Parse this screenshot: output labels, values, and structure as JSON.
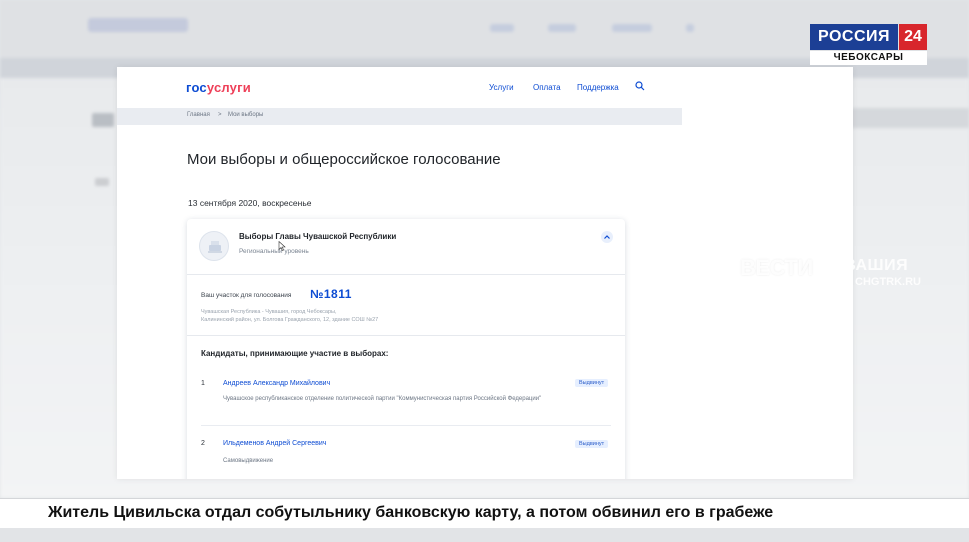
{
  "site": {
    "logo_part1": "гос",
    "logo_part2": "услуги",
    "nav": [
      "Услуги",
      "Оплата",
      "Поддержка"
    ],
    "breadcrumbs": [
      "Главная",
      ">",
      "Мои выборы"
    ]
  },
  "page": {
    "title": "Мои выборы и общероссийское голосование",
    "date": "13 сентября 2020, воскресенье"
  },
  "election": {
    "title": "Выборы Главы Чувашской Республики",
    "level": "Региональный уровень",
    "precinct_label": "Ваш участок для голосования",
    "precinct_number": "№1811",
    "address_line1": "Чувашская Республика - Чувашия, город Чебоксары,",
    "address_line2": "Калининский район, ул. Болгова Гражданского, 12, здание СОШ №27",
    "candidates_heading": "Кандидаты, принимающие участие в выборах:",
    "candidates": [
      {
        "num": "1",
        "name": "Андреев Александр Михайлович",
        "desc": "Чувашское республиканское отделение политической партии \"Коммунистическая партия Российской Федерации\"",
        "badge": "Выдвинут"
      },
      {
        "num": "2",
        "name": "Ильдеменов Андрей Сергеевич",
        "desc": "Самовыдвижение",
        "badge": "Выдвинут"
      }
    ]
  },
  "overlay": {
    "channel_name": "РОССИЯ",
    "channel_number": "24",
    "channel_city": "ЧЕБОКСАРЫ",
    "watermark_brand": "ВЕСТИ",
    "watermark_region": "ЧУВАШИЯ",
    "watermark_site": "CHGTRK.RU",
    "ticker": "Житель Цивильска отдал собутыльнику банковскую карту, а потом обвинил его в грабеже"
  },
  "colors": {
    "gov_blue": "#0d4cd3",
    "gov_red": "#ee3f58",
    "channel_blue": "#1c3f95",
    "channel_red": "#d8262c"
  }
}
